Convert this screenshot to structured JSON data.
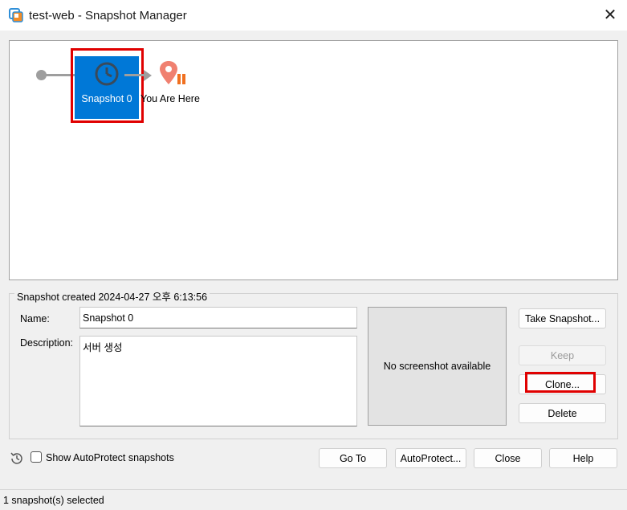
{
  "window": {
    "title": "test-web - Snapshot Manager",
    "app_icon": "vmware-workstation-icon",
    "close_glyph": "✕"
  },
  "tree": {
    "snapshot_node_label": "Snapshot 0",
    "snapshot_node_icon": "clock-icon",
    "you_are_here_label": "You Are Here",
    "you_are_here_icon": "location-pin-icon",
    "selected_color": "#0078d7"
  },
  "details": {
    "group_title": "Snapshot created 2024-04-27 오후 6:13:56",
    "name_label": "Name:",
    "name_value": "Snapshot 0",
    "description_label": "Description:",
    "description_value": "서버 생성",
    "screenshot_text": "No screenshot available"
  },
  "side_buttons": {
    "take_snapshot": "Take Snapshot...",
    "keep": "Keep",
    "clone": "Clone...",
    "delete": "Delete"
  },
  "bottom": {
    "show_autoprotect_label": "Show AutoProtect snapshots",
    "show_autoprotect_checked": false,
    "go_to": "Go To",
    "autoprotect": "AutoProtect...",
    "close": "Close",
    "help": "Help"
  },
  "status": {
    "text": "1 snapshot(s) selected"
  },
  "highlight_color": "#e00000"
}
